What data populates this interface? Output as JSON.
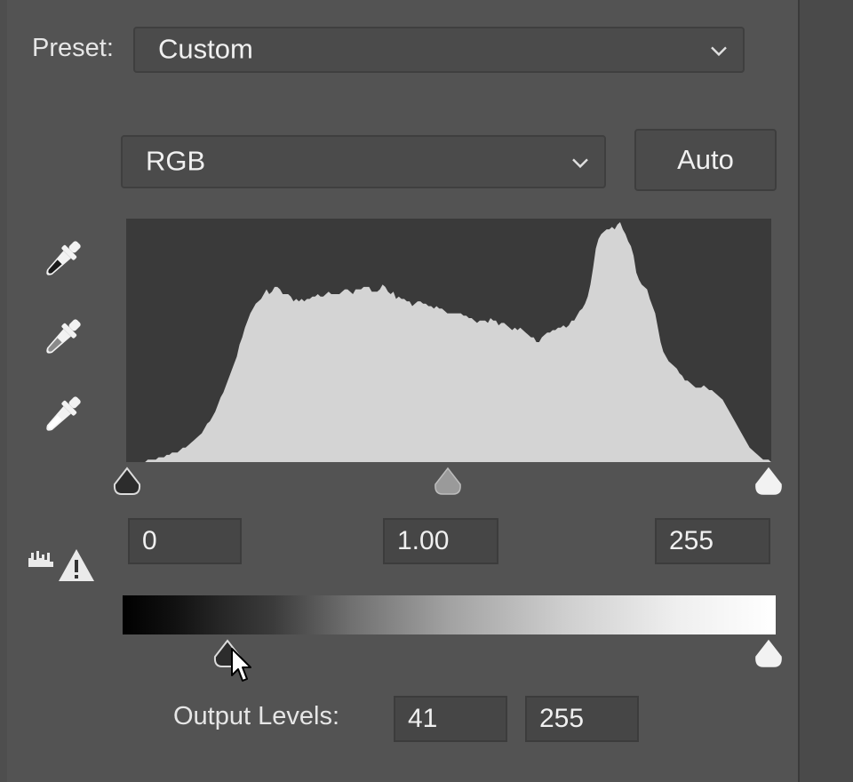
{
  "preset": {
    "label": "Preset:",
    "value": "Custom"
  },
  "channel": {
    "value": "RGB"
  },
  "auto_button": {
    "label": "Auto"
  },
  "input_levels": {
    "black": "0",
    "gamma": "1.00",
    "white": "255"
  },
  "output_levels": {
    "label": "Output Levels:",
    "black": "41",
    "white": "255"
  },
  "icons": {
    "eyedroppers": [
      "black-point-eyedropper-icon",
      "gray-point-eyedropper-icon",
      "white-point-eyedropper-icon"
    ],
    "clipping": "clipping-warning-icon",
    "chevron": "chevron-down-icon"
  },
  "colors": {
    "panel": "#535353",
    "histogram_bg": "#3a3a3a",
    "histogram_fill": "#d4d4d4"
  },
  "histogram": [
    0,
    0,
    0,
    0,
    0,
    0,
    0,
    0,
    1,
    1,
    1,
    1,
    2,
    2,
    2,
    3,
    3,
    4,
    4,
    4,
    5,
    6,
    6,
    7,
    8,
    9,
    10,
    11,
    12,
    14,
    16,
    17,
    19,
    21,
    24,
    27,
    29,
    32,
    35,
    38,
    41,
    44,
    49,
    52,
    56,
    59,
    62,
    64,
    66,
    67,
    68,
    70,
    72,
    70,
    71,
    73,
    73,
    72,
    70,
    70,
    70,
    69,
    67,
    68,
    67,
    68,
    67,
    68,
    68,
    69,
    69,
    70,
    69,
    69,
    70,
    71,
    70,
    70,
    70,
    70,
    71,
    72,
    72,
    71,
    70,
    72,
    72,
    72,
    73,
    73,
    73,
    71,
    71,
    71,
    72,
    74,
    73,
    71,
    70,
    71,
    68,
    69,
    68,
    68,
    67,
    67,
    65,
    66,
    67,
    67,
    66,
    66,
    65,
    65,
    64,
    65,
    64,
    64,
    63,
    62,
    62,
    62,
    62,
    62,
    62,
    61,
    61,
    60,
    60,
    59,
    58,
    59,
    59,
    59,
    58,
    60,
    59,
    59,
    57,
    58,
    58,
    57,
    56,
    55,
    56,
    55,
    56,
    55,
    54,
    53,
    52,
    52,
    50,
    50,
    52,
    53,
    54,
    54,
    55,
    55,
    56,
    56,
    57,
    56,
    57,
    59,
    59,
    61,
    63,
    64,
    66,
    69,
    74,
    81,
    89,
    93,
    95,
    96,
    97,
    97,
    98,
    97,
    99,
    100,
    97,
    95,
    92,
    90,
    86,
    79,
    76,
    74,
    73,
    72,
    68,
    65,
    62,
    56,
    50,
    46,
    44,
    42,
    41,
    40,
    39,
    37,
    36,
    34,
    34,
    33,
    32,
    31,
    31,
    31,
    32,
    31,
    30,
    30,
    29,
    28,
    27,
    26,
    24,
    22,
    20,
    18,
    16,
    14,
    12,
    10,
    8,
    6,
    5,
    4,
    3,
    2,
    1,
    1,
    1,
    0
  ]
}
